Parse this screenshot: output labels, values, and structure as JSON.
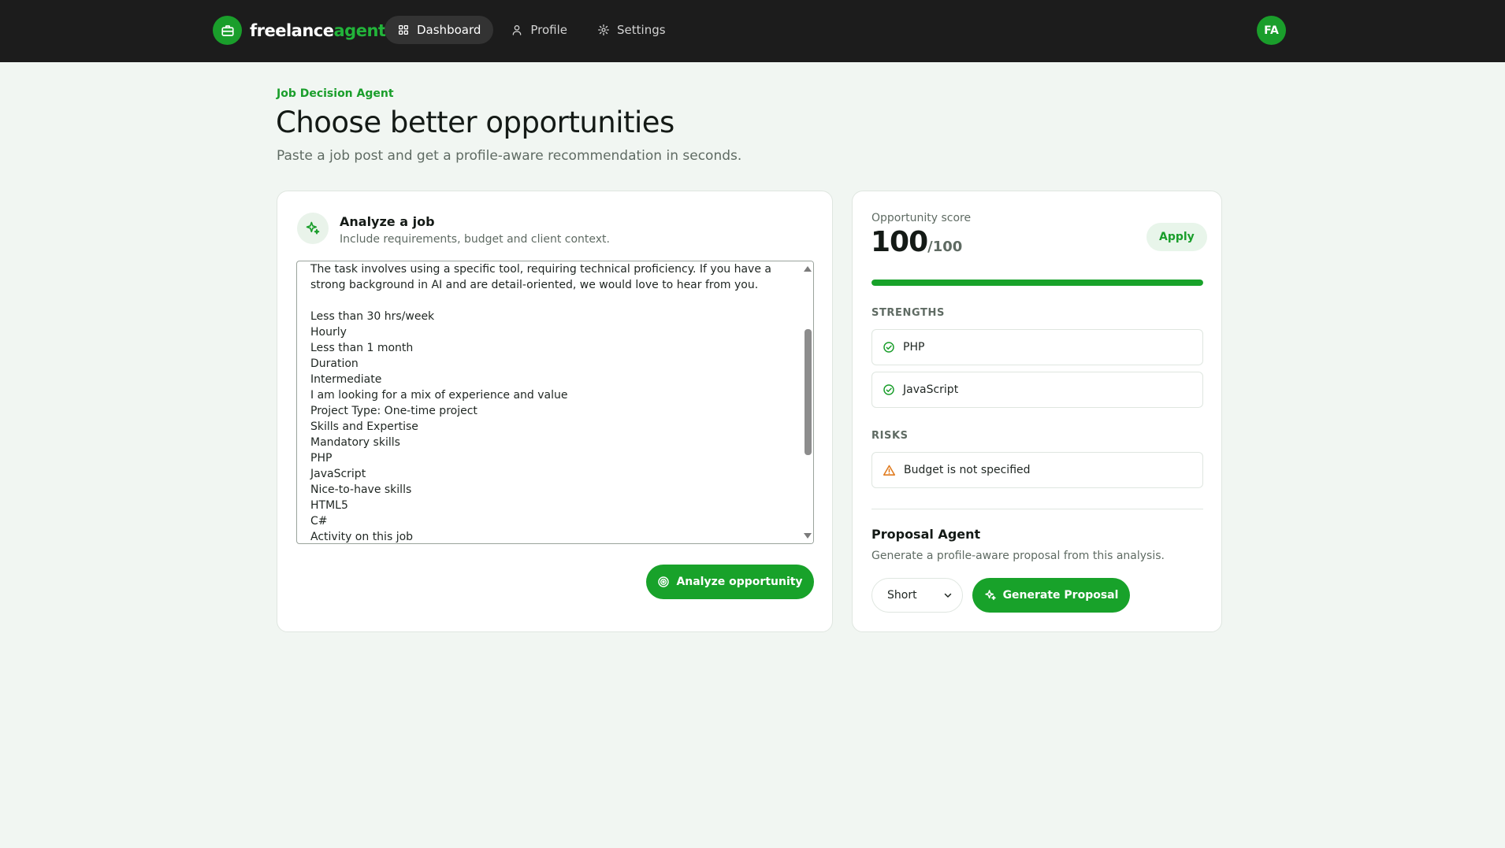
{
  "brand": {
    "name_main": "freelance",
    "name_accent": "agent",
    "logo_icon": "briefcase-icon"
  },
  "nav": {
    "items": [
      {
        "label": "Dashboard",
        "icon": "grid-icon",
        "active": true
      },
      {
        "label": "Profile",
        "icon": "user-icon",
        "active": false
      },
      {
        "label": "Settings",
        "icon": "gear-icon",
        "active": false
      }
    ],
    "avatar_initials": "FA"
  },
  "header": {
    "eyebrow": "Job Decision Agent",
    "title": "Choose better opportunities",
    "subtitle": "Paste a job post and get a profile-aware recommendation in seconds."
  },
  "analyze": {
    "title": "Analyze a job",
    "description": "Include requirements, budget and client context.",
    "job_text": "The task involves using a specific tool, requiring technical proficiency. If you have a strong background in AI and are detail-oriented, we would love to hear from you.\n\nLess than 30 hrs/week\nHourly\nLess than 1 month\nDuration\nIntermediate\nI am looking for a mix of experience and value\nProject Type: One-time project\nSkills and Expertise\nMandatory skills\nPHP\nJavaScript\nNice-to-have skills\nHTML5\nC#\nActivity on this job",
    "button_label": "Analyze opportunity"
  },
  "result": {
    "score_label": "Opportunity score",
    "score": "100",
    "score_max": "/100",
    "score_fraction": 1.0,
    "recommendation": "Apply",
    "strengths_label": "STRENGTHS",
    "strengths": [
      "PHP",
      "JavaScript"
    ],
    "risks_label": "RISKS",
    "risks": [
      "Budget is not specified"
    ]
  },
  "proposal": {
    "title": "Proposal Agent",
    "description": "Generate a profile-aware proposal from this analysis.",
    "length_selected": "Short",
    "button_label": "Generate Proposal"
  },
  "colors": {
    "accent": "#18a22a",
    "topbar": "#1c1c1c",
    "background": "#f1f6f2",
    "risk": "#e07b1f"
  }
}
